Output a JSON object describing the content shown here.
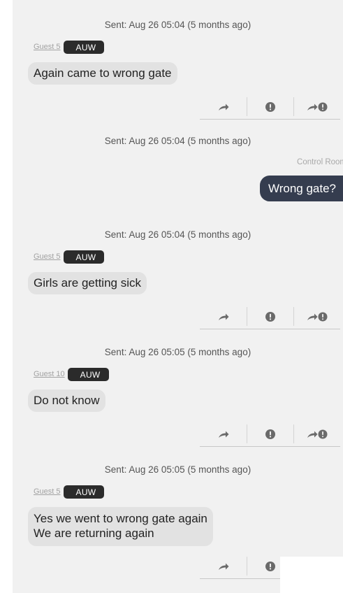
{
  "messages": [
    {
      "sent": "Sent: Aug 26 05:04 (5 months ago)",
      "sender": "Guest 5",
      "badge": "AUW",
      "text": "Again came to wrong gate"
    },
    {
      "sent": "Sent: Aug 26 05:04 (5 months ago)",
      "sender": "Control Room",
      "text": "Wrong gate?"
    },
    {
      "sent": "Sent: Aug 26 05:04 (5 months ago)",
      "sender": "Guest 5",
      "badge": "AUW",
      "text": "Girls are getting sick"
    },
    {
      "sent": "Sent: Aug 26 05:05 (5 months ago)",
      "sender": "Guest 10",
      "badge": "AUW",
      "text": "Do not know"
    },
    {
      "sent": "Sent: Aug 26 05:05 (5 months ago)",
      "sender": "Guest 5",
      "badge": "AUW",
      "text": "Yes we went to wrong gate again\nWe are returning again"
    }
  ],
  "icons": {
    "forward": "forward-arrow-icon",
    "alert": "exclamation-circle-icon",
    "forward_alert": "forward-with-alert-icon"
  },
  "colors": {
    "chat_background": "#f1f1f1",
    "incoming_bubble": "#e2e2e2",
    "outgoing_bubble": "#353d4f",
    "badge": "#2b2b2b",
    "action_icon": "#6a6a6a"
  }
}
